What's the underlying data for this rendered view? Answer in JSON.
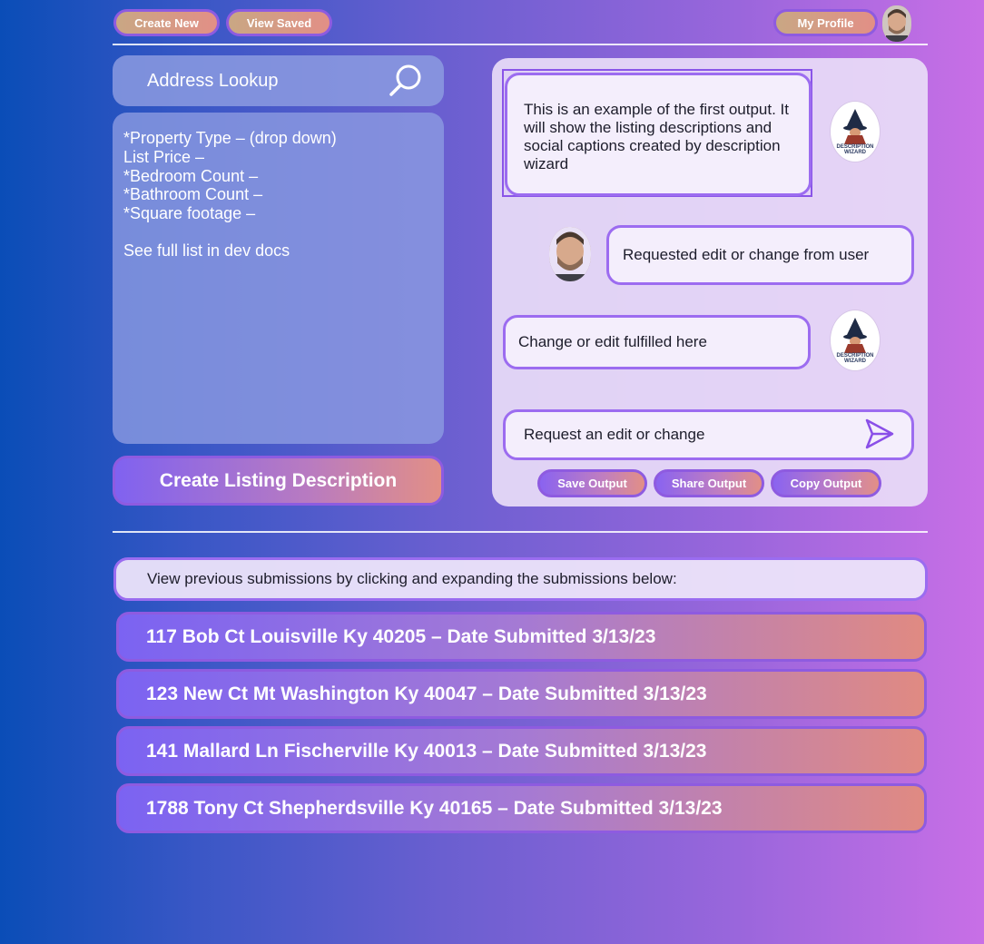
{
  "nav": {
    "create_new": "Create New",
    "view_saved": "View Saved",
    "my_profile": "My Profile"
  },
  "lookup": {
    "label": "Address Lookup",
    "icon": "search-icon"
  },
  "fields": {
    "property_type": "*Property Type – (drop down)",
    "list_price": "List Price –",
    "bedroom_count": "*Bedroom Count –",
    "bathroom_count": "*Bathroom Count –",
    "square_footage": "*Square footage –",
    "docs_note": "See full list  in dev docs"
  },
  "create_listing_label": "Create Listing Description",
  "chat": {
    "first_output": "This is an example of the first output. It will show the listing descriptions and social captions created by description wizard",
    "user_request": "Requested edit or change from user",
    "fulfilled": "Change or edit fulfilled here",
    "input_placeholder": "Request an edit or change",
    "bot_label": "DESCRIPTION WIZARD",
    "send_icon": "send-icon"
  },
  "output_actions": {
    "save": "Save Output",
    "share": "Share Output",
    "copy": "Copy Output"
  },
  "previous": {
    "header": "View previous submissions by clicking and expanding the submissions below:",
    "items": [
      "117 Bob Ct Louisville Ky 40205 – Date Submitted 3/13/23",
      "123 New Ct Mt Washington Ky 40047 – Date Submitted 3/13/23",
      "141 Mallard Ln Fischerville Ky 40013 – Date Submitted 3/13/23",
      "1788 Tony Ct Shepherdsville Ky 40165 – Date Submitted 3/13/23"
    ]
  },
  "colors": {
    "accent_border": "#8e5be0",
    "pill_start": "#c9a784",
    "pill_end": "#e28f86",
    "panel_bg": "#e8dcf8"
  }
}
